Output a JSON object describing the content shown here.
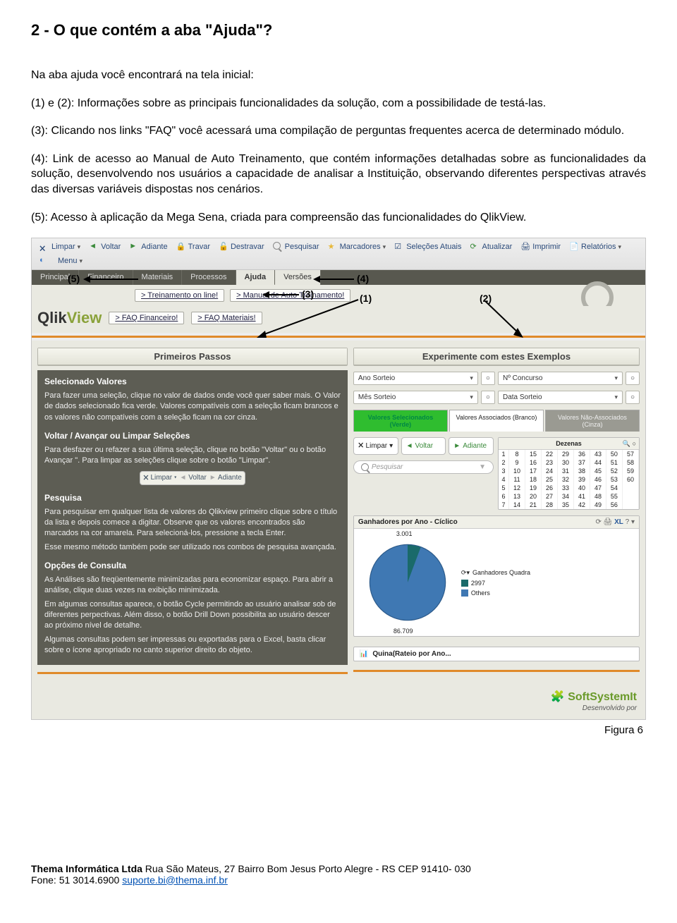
{
  "doc": {
    "title": "2 - O que contém a aba \"Ajuda\"?",
    "p1": "Na aba ajuda você encontrará na tela inicial:",
    "p2": "(1) e (2): Informações sobre as principais funcionalidades da solução, com a possibilidade de testá-las.",
    "p3": "(3): Clicando nos links \"FAQ\" você acessará uma compilação de perguntas frequentes acerca de determinado módulo.",
    "p4": "(4): Link de acesso ao Manual de Auto Treinamento, que contém informações detalhadas sobre as funcionalidades da solução, desenvolvendo nos usuários a capacidade de analisar a Instituição, observando diferentes perspectivas através das diversas variáveis dispostas nos cenários.",
    "p5": "(5): Acesso à aplicação da Mega Sena, criada para compreensão das funcionalidades do QlikView.",
    "figcap": "Figura 6"
  },
  "annotations": {
    "n1": "(1)",
    "n2": "(2)",
    "n3": "(3)",
    "n4": "(4)",
    "n5": "(5)"
  },
  "toolbar": {
    "limpar": "Limpar",
    "voltar": "Voltar",
    "adiante": "Adiante",
    "travar": "Travar",
    "destravar": "Destravar",
    "pesquisar": "Pesquisar",
    "marcadores": "Marcadores",
    "selecoes": "Seleções Atuais",
    "atualizar": "Atualizar",
    "imprimir": "Imprimir",
    "relatorios": "Relatórios",
    "menu": "Menu"
  },
  "menutabs": {
    "principal": "Principal",
    "financeiro": "Financeiro",
    "materiais": "Materiais",
    "processos": "Processos",
    "ajuda": "Ajuda",
    "versoes": "Versões"
  },
  "links": {
    "treinamento": "> Treinamento on line!",
    "manual": "> Manual de Auto Treinamento!",
    "faq_fin": "> FAQ Financeiro!",
    "faq_mat": "> FAQ Materiais!"
  },
  "logo": {
    "qlik": "Qlik",
    "view": "View"
  },
  "panels": {
    "primeiros": "Primeiros Passos",
    "experimente": "Experimente com estes Exemplos"
  },
  "help": {
    "h1": "Selecionado Valores",
    "p1": "Para fazer uma seleção, clique no valor de dados onde você quer saber mais. O Valor de dados selecionado fica verde. Valores compatíveis com a seleção ficam brancos e os valores não compatíveis com a seleção ficam na cor cinza.",
    "h2": "Voltar / Avançar ou Limpar Seleções",
    "p2": "Para desfazer ou refazer a sua última seleção, clique no botão \"Voltar\" ou o botão Avançar \". Para limpar as seleções clique sobre o botão \"Limpar\".",
    "h3": "Pesquisa",
    "p3": "Para pesquisar em qualquer lista de valores do Qlikview primeiro clique sobre o título da lista e depois comece a digitar. Observe que os valores encontrados são marcados na cor amarela. Para selecioná-los, pressione a tecla Enter.",
    "p3b": "Esse mesmo método também pode ser utilizado nos combos de pesquisa avançada.",
    "h4": "Opções de Consulta",
    "p4": "As Análises são freqüentemente minimizadas para economizar espaço. Para abrir a análise, clique duas vezes na exibição minimizada.",
    "p4b": "Em algumas consultas aparece, o botão Cycle       permitindo ao usuário analisar sob de diferentes perpectivas. Além disso, o botão   Drill Down      possibilita ao usuário descer ao próximo nível de detalhe.",
    "p4c": "Algumas consultas podem ser impressas ou exportadas para o Excel, basta clicar sobre o ícone        apropriado no canto superior direito do objeto."
  },
  "selects": {
    "ano": "Ano Sorteio",
    "mes": "Mês Sorteio",
    "nconc": "Nº Concurso",
    "data": "Data Sorteio",
    "tab_sel": "Valores Selecionados (Verde)",
    "tab_assoc": "Valores Associados (Branco)",
    "tab_nao": "Valores Não-Associados (Cinza)"
  },
  "controls": {
    "limpar": "Limpar",
    "voltar": "Voltar",
    "adiante": "Adiante",
    "pesquisar": "Pesquisar"
  },
  "dezenas": {
    "title": "Dezenas",
    "rows": [
      [
        "1",
        "8",
        "15",
        "22",
        "29",
        "36",
        "43",
        "50",
        "57"
      ],
      [
        "2",
        "9",
        "16",
        "23",
        "30",
        "37",
        "44",
        "51",
        "58"
      ],
      [
        "3",
        "10",
        "17",
        "24",
        "31",
        "38",
        "45",
        "52",
        "59"
      ],
      [
        "4",
        "11",
        "18",
        "25",
        "32",
        "39",
        "46",
        "53",
        "60"
      ],
      [
        "5",
        "12",
        "19",
        "26",
        "33",
        "40",
        "47",
        "54",
        ""
      ],
      [
        "6",
        "13",
        "20",
        "27",
        "34",
        "41",
        "48",
        "55",
        ""
      ],
      [
        "7",
        "14",
        "21",
        "28",
        "35",
        "42",
        "49",
        "56",
        ""
      ]
    ]
  },
  "chart": {
    "title": "Ganhadores por Ano - Cíclico",
    "legend_quadra": "Ganhadores Quadra",
    "legend_2997": "2997",
    "legend_others": "Others",
    "quina": "Quina(Rateio por Ano..."
  },
  "chart_data": {
    "type": "pie",
    "title": "Ganhadores por Ano - Cíclico",
    "values": [
      86709,
      3001
    ],
    "labels": [
      "Others",
      "2997"
    ],
    "data_labels": [
      "86.709",
      "3.001"
    ],
    "legend_title": "Ganhadores Quadra"
  },
  "ssit": {
    "logo": "SoftSystemIt",
    "dev": "Desenvolvido por"
  },
  "footer": {
    "line1a": "Thema Informática Ltda",
    "line1b": "   Rua São Mateus, 27  Bairro Bom Jesus  Porto Alegre - RS CEP 91410- 030",
    "line2a": "Fone: 51 3014.6900  ",
    "line2b": "suporte.bi@thema.inf.br"
  }
}
